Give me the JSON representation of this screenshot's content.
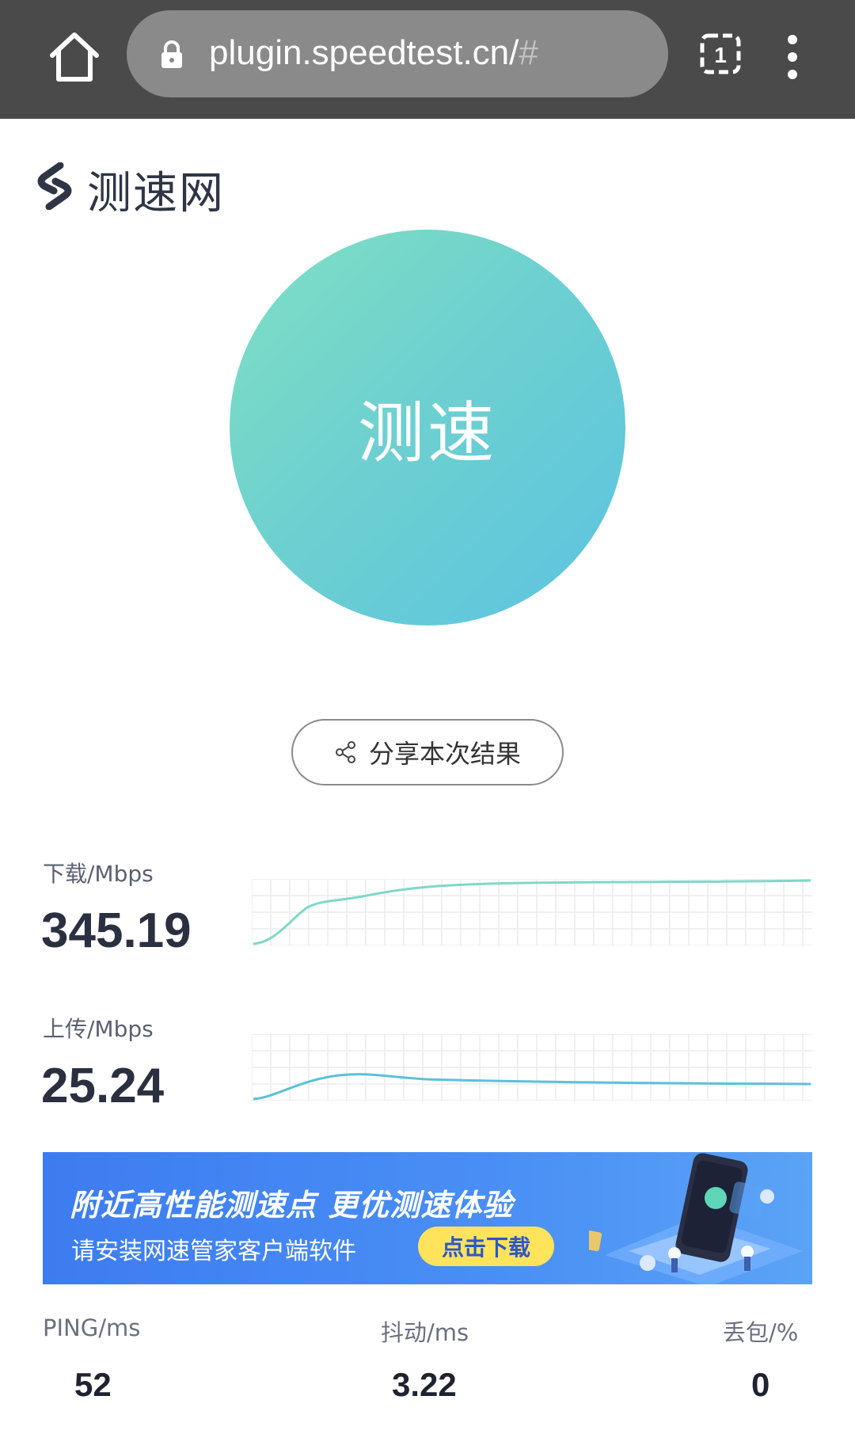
{
  "browser": {
    "url_main": "plugin.speedtest.cn/",
    "url_hash": "#",
    "tab_count": "1",
    "bar_color": "#4a4a4a"
  },
  "logo": {
    "text": "测速网"
  },
  "main": {
    "start_button_label": "测速",
    "share_button_label": "分享本次结果"
  },
  "download": {
    "label": "下载/Mbps",
    "value": "345.19",
    "line_color": "#7fd8c8"
  },
  "upload": {
    "label": "上传/Mbps",
    "value": "25.24",
    "line_color": "#5cc0da"
  },
  "banner": {
    "title": "附近高性能测速点  更优测速体验",
    "subtitle": "请安装网速管家客户端软件",
    "cta_label": "点击下载"
  },
  "stats": {
    "ping_label": "PING/ms",
    "ping_value": "52",
    "jitter_label": "抖动/ms",
    "jitter_value": "3.22",
    "loss_label": "丢包/%",
    "loss_value": "0"
  }
}
